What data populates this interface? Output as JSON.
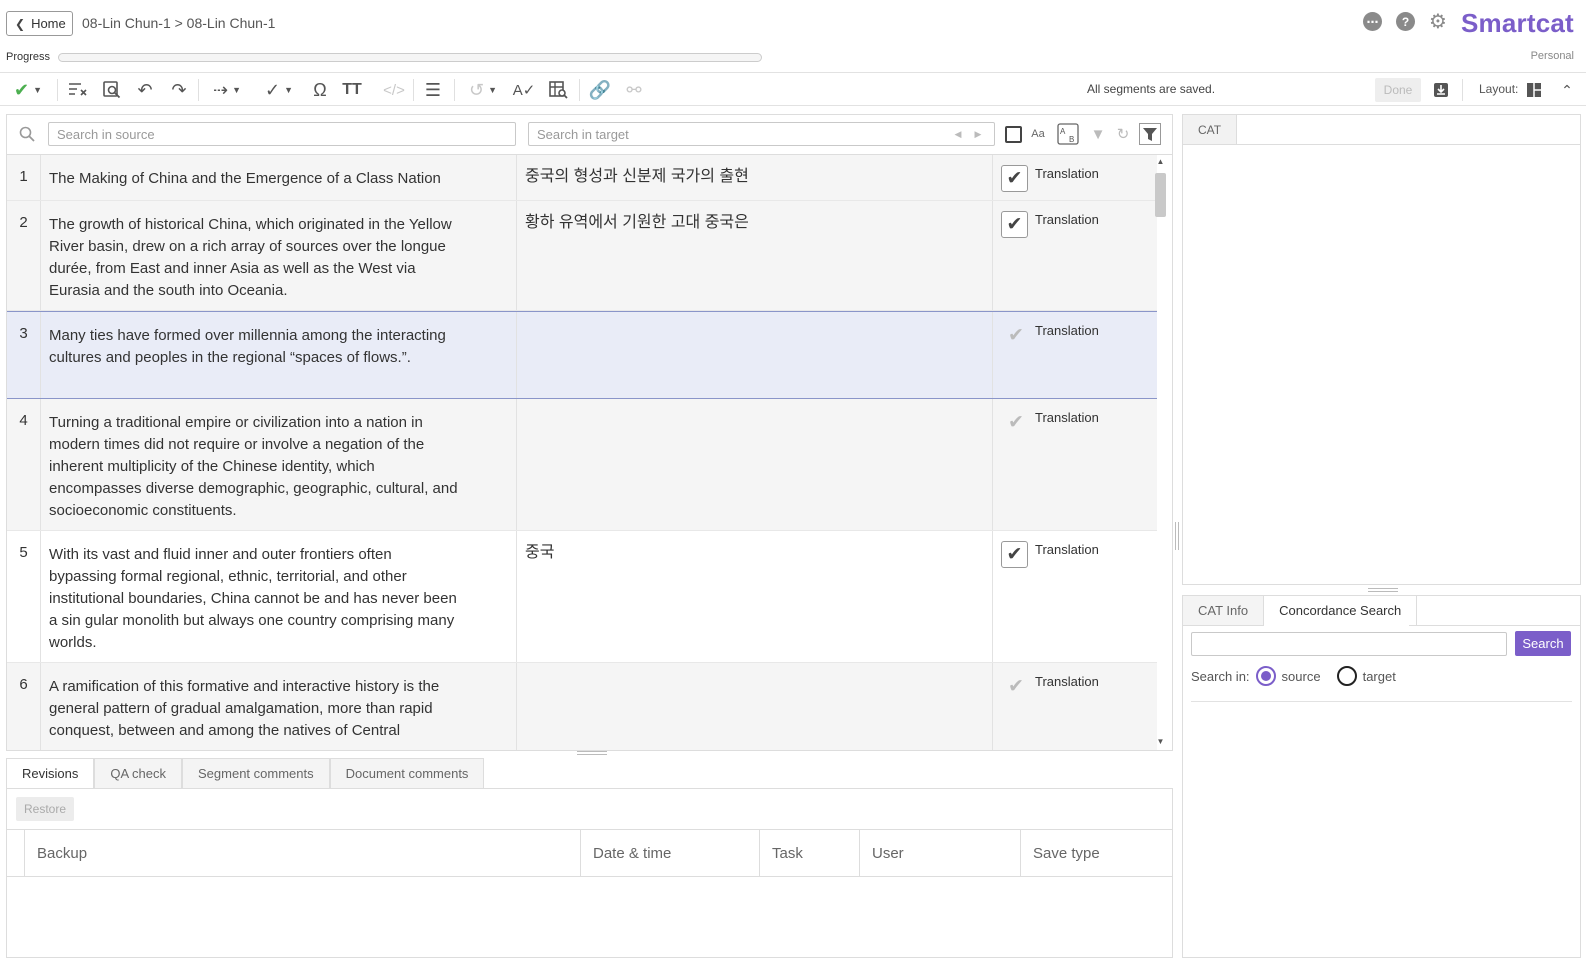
{
  "header": {
    "home_label": "Home",
    "breadcrumb": "08-Lin Chun-1 > 08-Lin Chun-1",
    "brand": "Smartcat",
    "plan": "Personal",
    "progress_label": "Progress",
    "progress": 0.0,
    "icons": [
      "chat-icon",
      "help-icon",
      "gear-icon"
    ]
  },
  "toolbar": {
    "icons": [
      "confirm-check-icon",
      "clear-formatting-icon",
      "find-replace-icon",
      "undo-icon",
      "redo-icon",
      "go-to-next-icon",
      "copy-source-icon",
      "special-char-icon",
      "change-case-icon",
      "tags-icon",
      "split-merge-icon",
      "revert-icon",
      "spellcheck-icon",
      "concordance-icon",
      "join-segments-icon",
      "unjoin-segments-icon"
    ],
    "save_status": "All segments are saved.",
    "done_label": "Done",
    "layout_label": "Layout:"
  },
  "filter": {
    "source_placeholder": "Search in source",
    "target_placeholder": "Search in target",
    "case_label": "Aa"
  },
  "segments": [
    {
      "num": "1",
      "source": "The Making of China and the Emergence of a Class Nation",
      "target": "중국의 형성과 신분제 국가의 출현",
      "status": "Translation",
      "confirmed": true
    },
    {
      "num": "2",
      "source": "The growth of historical China, which originated in the Yellow River basin, drew on a rich array of sources over the longue durée, from East and inner Asia as well as the West via Eurasia and the south into Oceania.",
      "target": "황하 유역에서 기원한 고대 중국은",
      "status": "Translation",
      "confirmed": true
    },
    {
      "num": "3",
      "source": "Many ties have formed over millennia among the interacting cultures and peoples in the regional “spaces of flows.”.",
      "target": "",
      "status": "Translation",
      "confirmed": false
    },
    {
      "num": "4",
      "source": "Turning a traditional empire or civilization into a nation in modern times did not require or involve a negation of the inherent multiplicity of the Chinese identity, which encompasses diverse demographic, geographic, cultural, and socioeconomic constituents.",
      "target": "",
      "status": "Translation",
      "confirmed": false
    },
    {
      "num": "5",
      "source": "With its vast and fluid inner and outer frontiers often bypassing formal regional, ethnic, territorial, and other institutional boundaries, China cannot be and has never been a sin gular monolith but always one country comprising many worlds.",
      "target": "중국",
      "status": "Translation",
      "confirmed": true
    },
    {
      "num": "6",
      "source": "A ramification of this formative and interactive history is the general pattern of gradual amalgamation, more than rapid conquest, between and among the natives of Central",
      "target": "",
      "status": "Translation",
      "confirmed": false
    }
  ],
  "bottom": {
    "tabs": [
      "Revisions",
      "QA check",
      "Segment comments",
      "Document comments"
    ],
    "restore_label": "Restore",
    "columns": [
      "Backup",
      "Date & time",
      "Task",
      "User",
      "Save type"
    ]
  },
  "cat": {
    "tab_label": "CAT"
  },
  "concordance": {
    "tabs": [
      "CAT Info",
      "Concordance Search"
    ],
    "search_button": "Search",
    "search_in_label": "Search in:",
    "source_option": "source",
    "target_option": "target",
    "selected": "source"
  }
}
